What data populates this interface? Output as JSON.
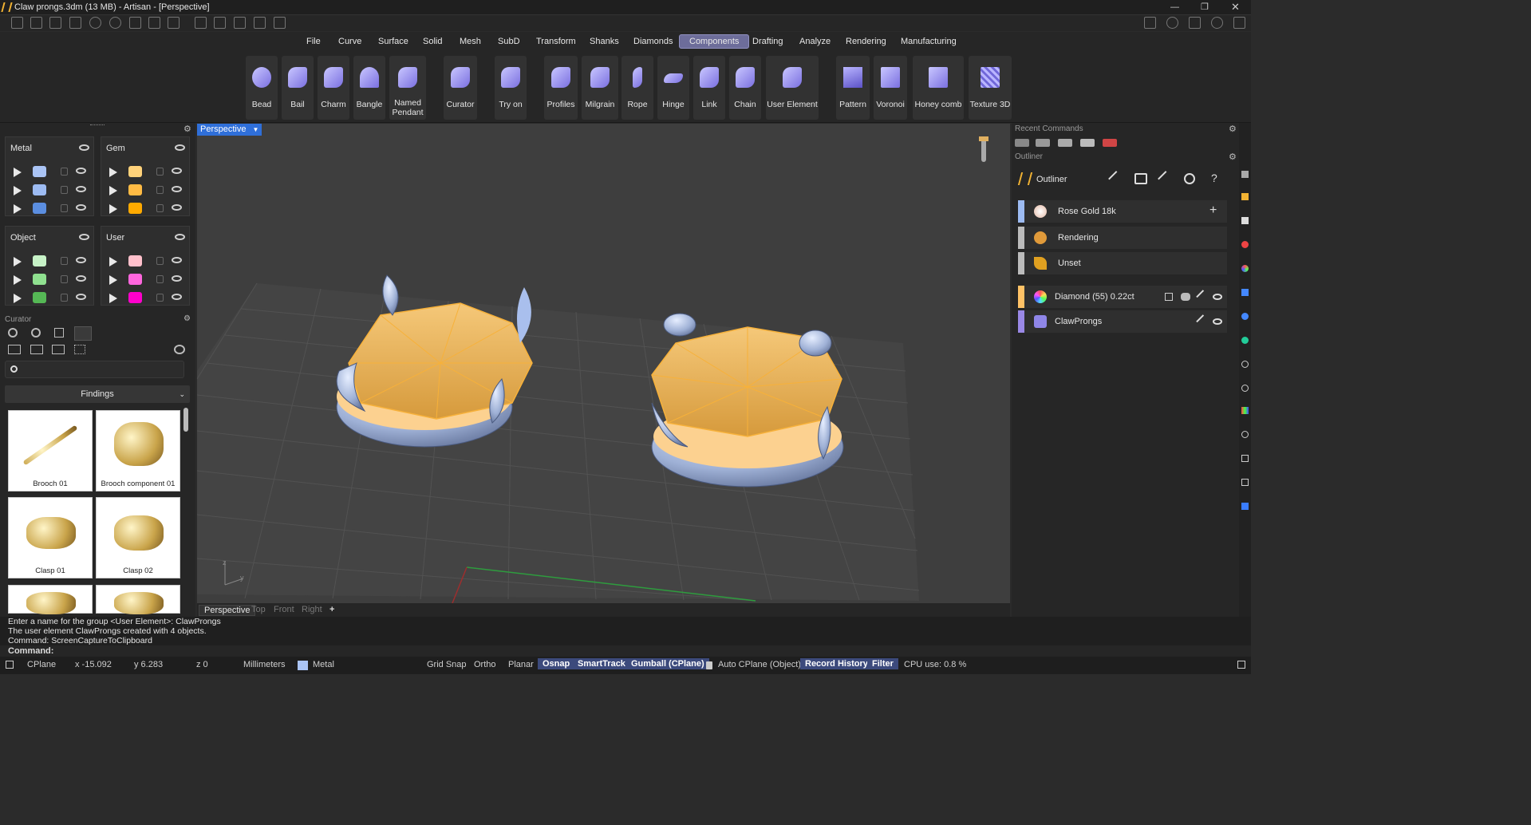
{
  "titlebar": {
    "title": "Claw prongs.3dm (13 MB) - Artisan - [Perspective]"
  },
  "menu": {
    "tabs": [
      "File",
      "Curve",
      "Surface",
      "Solid",
      "Mesh",
      "SubD",
      "Transform",
      "Shanks",
      "Diamonds",
      "Components",
      "Drafting",
      "Analyze",
      "Rendering",
      "Manufacturing"
    ],
    "active": "Components"
  },
  "toolbar": {
    "buttons": [
      "Bead",
      "Bail",
      "Charm",
      "Bangle",
      "Named Pendant",
      "Curator",
      "Try on",
      "Profiles",
      "Milgrain",
      "Rope",
      "Hinge",
      "Link",
      "Chain",
      "User Element",
      "Pattern",
      "Voronoi",
      "Honey comb",
      "Texture 3D"
    ]
  },
  "layers": {
    "metal": {
      "title": "Metal",
      "colors": [
        "#aac4f5",
        "#9dbbf2",
        "#5b8ee0"
      ]
    },
    "gem": {
      "title": "Gem",
      "colors": [
        "#ffd27a",
        "#ffbb44",
        "#ffaa00"
      ]
    },
    "object": {
      "title": "Object",
      "colors": [
        "#c7f2c7",
        "#8fe08f",
        "#55b855"
      ]
    },
    "user": {
      "title": "User",
      "colors": [
        "#ffc0cb",
        "#ff66dd",
        "#ff00cc"
      ]
    }
  },
  "curator": {
    "title": "Curator",
    "category": "Findings",
    "items": [
      "Brooch 01",
      "Brooch component 01",
      "Clasp 01",
      "Clasp 02"
    ]
  },
  "viewport": {
    "name": "Perspective",
    "tabs": [
      "Perspective",
      "Top",
      "Front",
      "Right"
    ]
  },
  "rightpanel": {
    "recent": "Recent Commands",
    "outliner_title": "Outliner",
    "outliner_header": "Outliner",
    "items": [
      {
        "label": "Rose Gold 18k",
        "color": "#9dbbf2"
      },
      {
        "label": "Rendering",
        "color": "#bbbbbb"
      },
      {
        "label": "Unset",
        "color": "#bbbbbb"
      },
      {
        "label": "Diamond (55) 0.22ct",
        "color": "#ffc266"
      },
      {
        "label": "ClawProngs",
        "color": "#9a88e6"
      }
    ]
  },
  "cmdlog": [
    "Enter a name for the group <User Element>: ClawProngs",
    "The user element ClawProngs created with 4 objects.",
    "Command: ScreenCaptureToClipboard"
  ],
  "cmdline": "Command:",
  "status": {
    "cplane": "CPlane",
    "x": "x -15.092",
    "y": "y 6.283",
    "z": "z 0",
    "units": "Millimeters",
    "layer": "Metal",
    "snap": "Grid Snap",
    "ortho": "Ortho",
    "planar": "Planar",
    "osnap": "Osnap",
    "smarttrack": "SmartTrack",
    "gumball": "Gumball (CPlane)",
    "autocplane": "Auto CPlane (Object)",
    "record": "Record History",
    "filter": "Filter",
    "cpu": "CPU use: 0.8 %"
  }
}
